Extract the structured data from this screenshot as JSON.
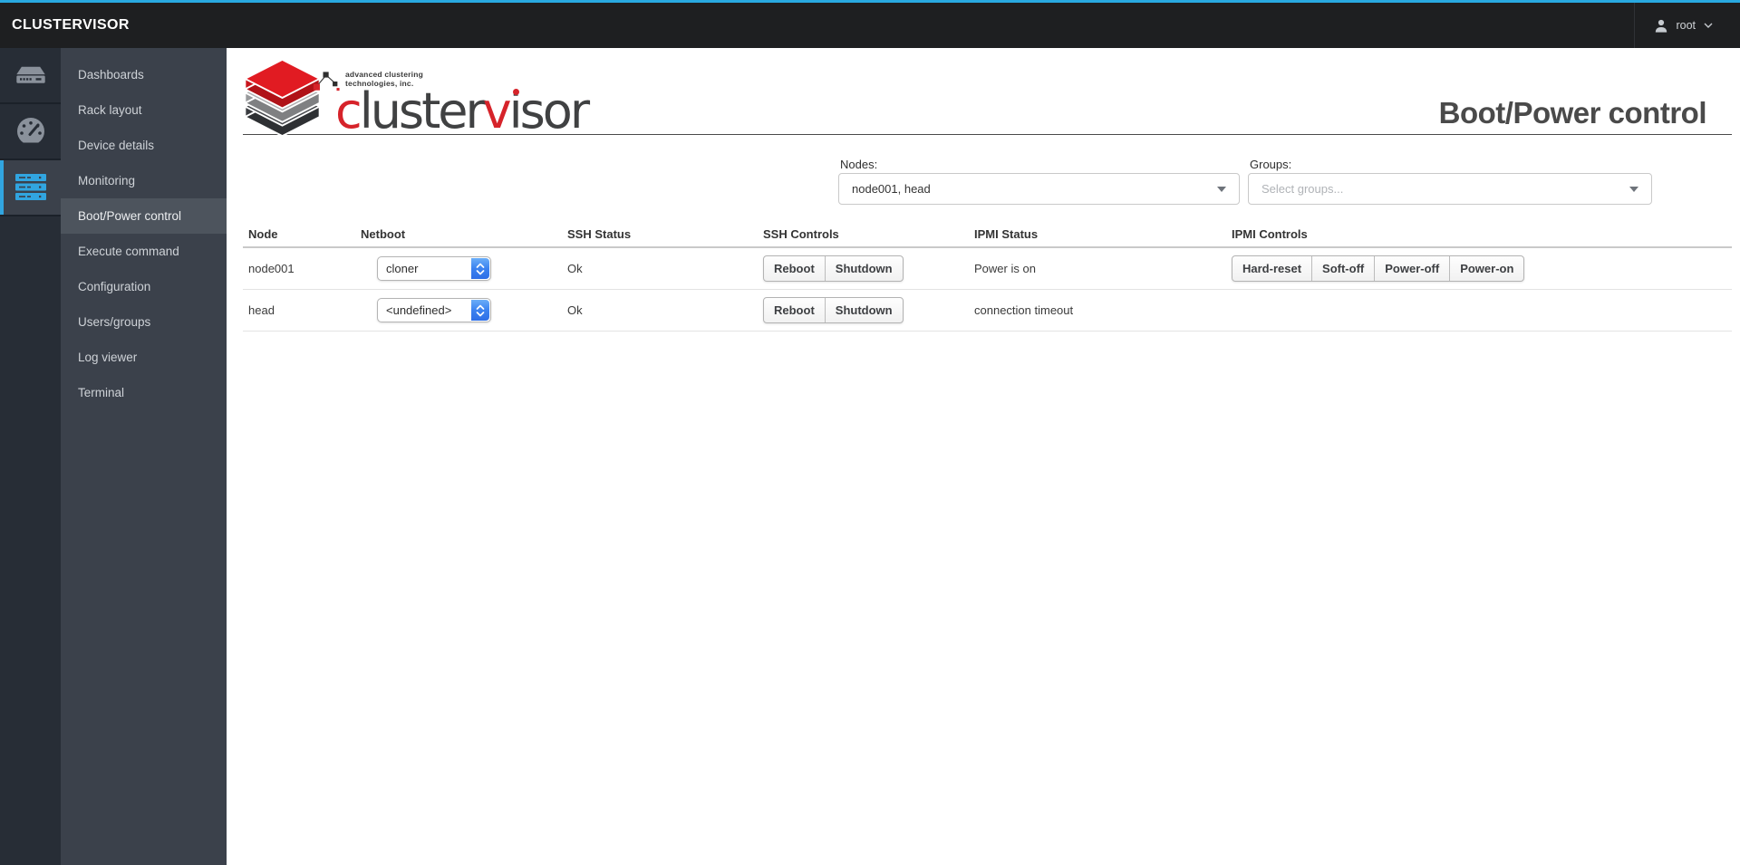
{
  "colors": {
    "accent_blue": "#29a9e1",
    "brand_red": "#d6232a",
    "select_blue": "#3b82f0"
  },
  "topbar": {
    "brand": "CLUSTERVISOR",
    "user": "root"
  },
  "sidebar": {
    "items": [
      {
        "id": "dashboards",
        "label": "Dashboards",
        "active": false
      },
      {
        "id": "rack-layout",
        "label": "Rack layout",
        "active": false
      },
      {
        "id": "device-details",
        "label": "Device details",
        "active": false
      },
      {
        "id": "monitoring",
        "label": "Monitoring",
        "active": false
      },
      {
        "id": "boot-power-control",
        "label": "Boot/Power control",
        "active": true
      },
      {
        "id": "execute-command",
        "label": "Execute command",
        "active": false
      },
      {
        "id": "configuration",
        "label": "Configuration",
        "active": false
      },
      {
        "id": "users-groups",
        "label": "Users/groups",
        "active": false
      },
      {
        "id": "log-viewer",
        "label": "Log viewer",
        "active": false
      },
      {
        "id": "terminal",
        "label": "Terminal",
        "active": false
      }
    ]
  },
  "header": {
    "title": "Boot/Power control",
    "logo": {
      "word_c": "c",
      "word_mid": "luster",
      "word_v": "v",
      "word_end": "isor",
      "tagline1": "advanced clustering",
      "tagline2": "technologies, inc."
    }
  },
  "filters": {
    "nodes_label": "Nodes:",
    "nodes_value": "node001, head",
    "groups_label": "Groups:",
    "groups_placeholder": "Select groups..."
  },
  "table": {
    "columns": [
      "Node",
      "Netboot",
      "SSH Status",
      "SSH Controls",
      "IPMI Status",
      "IPMI Controls"
    ],
    "ssh_controls": [
      "Reboot",
      "Shutdown"
    ],
    "ipmi_controls": [
      "Hard-reset",
      "Soft-off",
      "Power-off",
      "Power-on"
    ],
    "rows": [
      {
        "node": "node001",
        "netboot": "cloner",
        "ssh_status": "Ok",
        "ipmi_status": "Power is on",
        "ipmi_controls_visible": true
      },
      {
        "node": "head",
        "netboot": "<undefined>",
        "ssh_status": "Ok",
        "ipmi_status": "connection timeout",
        "ipmi_controls_visible": false
      }
    ]
  }
}
